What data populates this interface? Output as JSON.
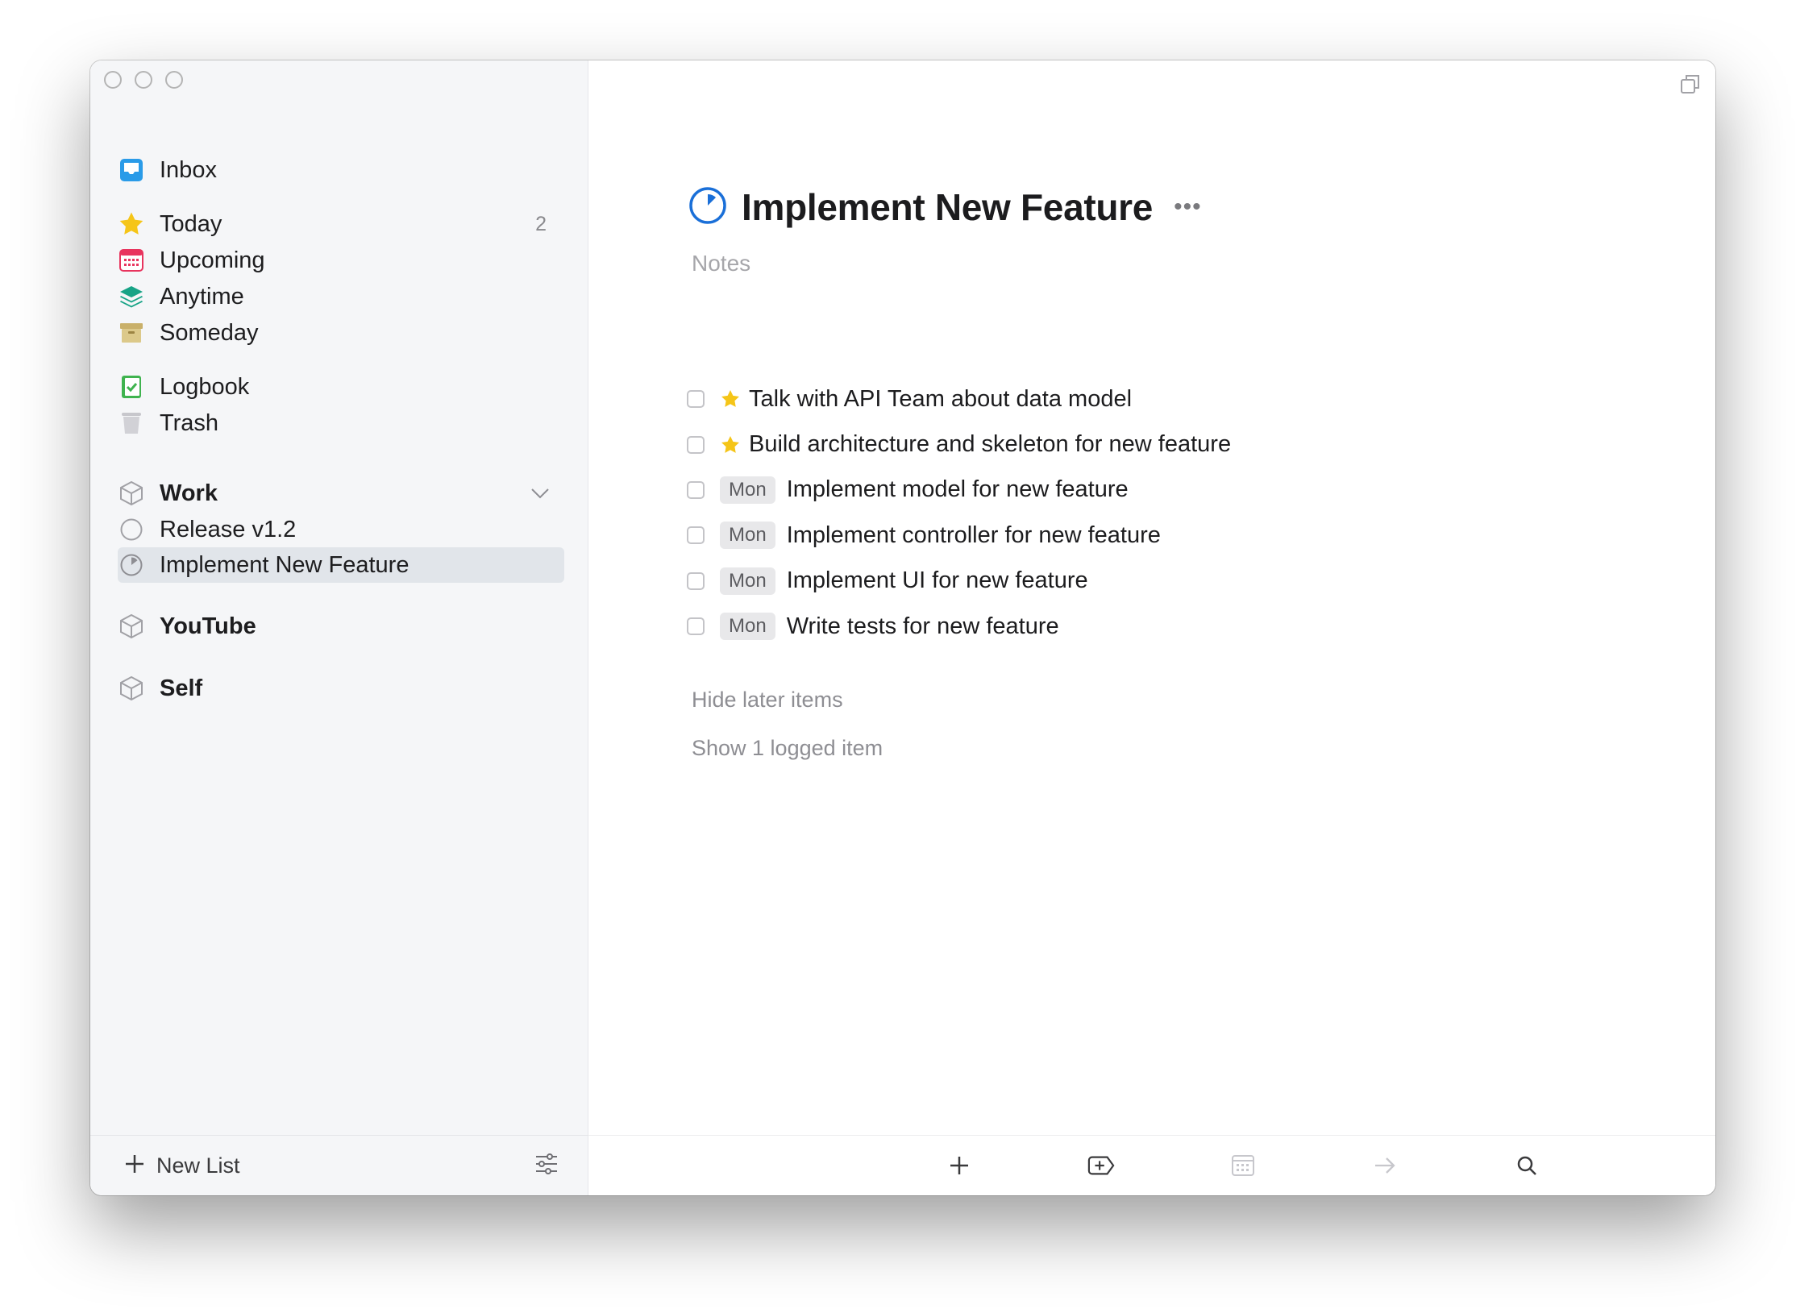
{
  "sidebar": {
    "inbox": {
      "label": "Inbox",
      "icon": "inbox-icon"
    },
    "today": {
      "label": "Today",
      "count": "2",
      "icon": "star-icon"
    },
    "upcoming": {
      "label": "Upcoming",
      "icon": "calendar-icon"
    },
    "anytime": {
      "label": "Anytime",
      "icon": "layers-icon"
    },
    "someday": {
      "label": "Someday",
      "icon": "archive-box-icon"
    },
    "logbook": {
      "label": "Logbook",
      "icon": "logbook-icon"
    },
    "trash": {
      "label": "Trash",
      "icon": "trash-icon"
    },
    "areas": [
      {
        "label": "Work",
        "projects": [
          {
            "label": "Release v1.2"
          },
          {
            "label": "Implement New Feature",
            "selected": true
          }
        ]
      },
      {
        "label": "YouTube"
      },
      {
        "label": "Self"
      }
    ],
    "new_list_label": "New List"
  },
  "project": {
    "title": "Implement New Feature",
    "more": "•••",
    "notes_placeholder": "Notes",
    "tasks": [
      {
        "text": "Talk with API Team about data model",
        "starred": true,
        "tag": ""
      },
      {
        "text": "Build architecture and skeleton for new feature",
        "starred": true,
        "tag": ""
      },
      {
        "text": "Implement model for new feature",
        "starred": false,
        "tag": "Mon"
      },
      {
        "text": "Implement controller for new feature",
        "starred": false,
        "tag": "Mon"
      },
      {
        "text": "Implement UI for new feature",
        "starred": false,
        "tag": "Mon"
      },
      {
        "text": "Write tests for new feature",
        "starred": false,
        "tag": "Mon"
      }
    ],
    "hide_later_label": "Hide later items",
    "show_logged_label": "Show 1 logged item"
  },
  "colors": {
    "accent": "#1a6fd8",
    "star": "#f5c518",
    "inbox": "#2a9be8",
    "upcoming": "#e8345e",
    "anytime": "#17a386",
    "someday": "#c9b06a",
    "logbook": "#3fb34f"
  }
}
